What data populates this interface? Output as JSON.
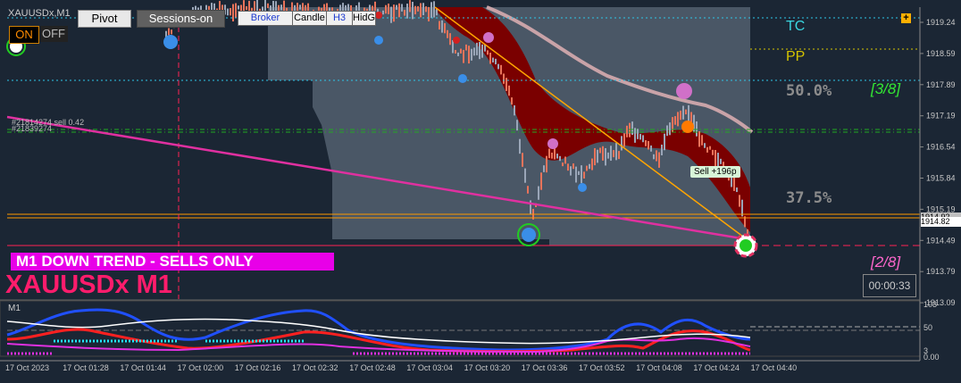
{
  "toolbar": {
    "symbol_period": "XAUUSDx,M1",
    "pivot_label": "Pivot",
    "sessions_label": "Sessions-on",
    "broker_label": "Broker",
    "candle_label": "Candle",
    "h3_label": "H3",
    "hidg_label": "HidG",
    "on_label": "ON",
    "off_label": "OFF"
  },
  "chart": {
    "trend_banner": "M1  DOWN TREND - SELLS ONLY",
    "symbol_label": "XAUUSDx M1",
    "countdown": "00:00:33",
    "order_line_label": "#21814274 sell 0.42",
    "order_line_label2": "#21839274",
    "trade_badge": "Sell +196p",
    "level_labels": {
      "tc": "TC",
      "pp": "PP"
    },
    "fib_pct": {
      "top": "50.0%",
      "mid": "37.5%"
    },
    "murrey_labels": {
      "upper": "[3/8]",
      "lower": "[2/8]"
    },
    "price_axis": [
      "1919.24",
      "1918.59",
      "1917.89",
      "1917.19",
      "1916.54",
      "1915.84",
      "1915.19",
      "1914.49",
      "1913.79",
      "1913.09"
    ],
    "current_price": "1914.82",
    "ask_price": "1914.92",
    "colors": {
      "background": "#1b2634",
      "cloud": "#7a0000",
      "banner": "#e800e8",
      "symbol": "#ff1c6c",
      "tc": "#3ad6e0",
      "pp": "#d4c400",
      "murrey": "#33e833",
      "murrey_lower": "#ff66cc"
    }
  },
  "indicator": {
    "label": "M1",
    "scale": [
      "103",
      "50",
      "3",
      "0.00"
    ]
  },
  "time_axis": [
    "17 Oct 2023",
    "17 Oct 01:28",
    "17 Oct 01:44",
    "17 Oct 02:00",
    "17 Oct 02:16",
    "17 Oct 02:32",
    "17 Oct 02:48",
    "17 Oct 03:04",
    "17 Oct 03:20",
    "17 Oct 03:36",
    "17 Oct 03:52",
    "17 Oct 04:08",
    "17 Oct 04:24",
    "17 Oct 04:40"
  ],
  "icons": {
    "plus": "plus-icon"
  }
}
